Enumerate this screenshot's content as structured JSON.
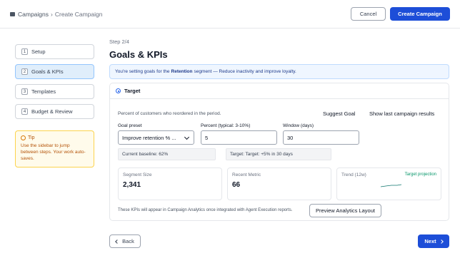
{
  "header": {
    "breadcrumb_root": "Campaigns",
    "breadcrumb_separator": "›",
    "breadcrumb_current": "Create Campaign",
    "cancel_label": "Cancel",
    "create_label": "Create Campaign",
    "accent_color": "#1d4ed8"
  },
  "sidebar": {
    "steps": [
      {
        "num": "1",
        "label": "Setup"
      },
      {
        "num": "2",
        "label": "Goals & KPIs",
        "active": true
      },
      {
        "num": "3",
        "label": "Templates"
      },
      {
        "num": "4",
        "label": "Budget & Review"
      }
    ],
    "tip_title": "Tip",
    "tip_text": "Use the sidebar to jump between steps. Your work auto-saves."
  },
  "main": {
    "step_label": "Step 2/4",
    "title": "Goals & KPIs",
    "banner_prefix": "You're setting goals for the",
    "banner_segment": "Retention",
    "banner_suffix": "segment — Reduce inactivity and improve loyalty."
  },
  "card": {
    "title": "Target",
    "description": "Percent of customers who reordered in the period.",
    "suggest_goal": "Suggest Goal",
    "show_last": "Show last campaign results",
    "goal_preset_label": "Goal preset",
    "goal_preset_value": "Improve retention % ...",
    "percent_label": "Percent (typical: 3-10%)",
    "percent_value": "5",
    "window_label": "Window (days)",
    "window_value": "30",
    "baseline_text": "Current baseline: 62%",
    "target_text": "Target: Target: +5% in 30 days",
    "metrics": [
      {
        "label": "Segment Size",
        "value": "2,341"
      },
      {
        "label": "Recent Metric",
        "value": "66"
      }
    ],
    "trend_label": "Trend (12w)",
    "trend_legend": "Target projection",
    "kpi_note": "These KPIs will appear in Campaign Analytics once integrated with Agent Execution reports.",
    "preview_label": "Preview Analytics Layout"
  },
  "footer": {
    "back_label": "Back",
    "next_label": "Next"
  }
}
